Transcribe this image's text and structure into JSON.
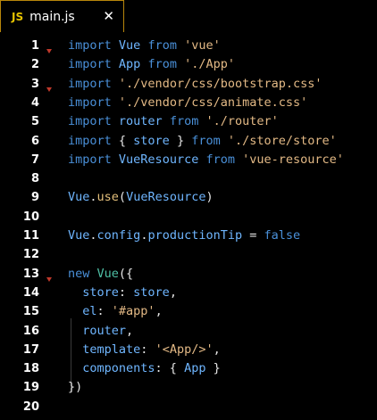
{
  "tab": {
    "icon": "JS",
    "label": "main.js",
    "close_icon": "✕"
  },
  "lines": [
    {
      "n": "1",
      "tokens": [
        [
          "kw",
          "import"
        ],
        [
          "op",
          " "
        ],
        [
          "id",
          "Vue"
        ],
        [
          "op",
          " "
        ],
        [
          "kw",
          "from"
        ],
        [
          "op",
          " "
        ],
        [
          "str",
          "'vue'"
        ]
      ]
    },
    {
      "n": "2",
      "tokens": [
        [
          "kw",
          "import"
        ],
        [
          "op",
          " "
        ],
        [
          "id",
          "App"
        ],
        [
          "op",
          " "
        ],
        [
          "kw",
          "from"
        ],
        [
          "op",
          " "
        ],
        [
          "str",
          "'./App'"
        ]
      ]
    },
    {
      "n": "3",
      "tokens": [
        [
          "kw",
          "import"
        ],
        [
          "op",
          " "
        ],
        [
          "str",
          "'./vendor/css/bootstrap.css'"
        ]
      ]
    },
    {
      "n": "4",
      "tokens": [
        [
          "kw",
          "import"
        ],
        [
          "op",
          " "
        ],
        [
          "str",
          "'./vendor/css/animate.css'"
        ]
      ]
    },
    {
      "n": "5",
      "tokens": [
        [
          "kw",
          "import"
        ],
        [
          "op",
          " "
        ],
        [
          "id",
          "router"
        ],
        [
          "op",
          " "
        ],
        [
          "kw",
          "from"
        ],
        [
          "op",
          " "
        ],
        [
          "str",
          "'./router'"
        ]
      ]
    },
    {
      "n": "6",
      "tokens": [
        [
          "kw",
          "import"
        ],
        [
          "op",
          " { "
        ],
        [
          "id",
          "store"
        ],
        [
          "op",
          " } "
        ],
        [
          "kw",
          "from"
        ],
        [
          "op",
          " "
        ],
        [
          "str",
          "'./store/store'"
        ]
      ]
    },
    {
      "n": "7",
      "tokens": [
        [
          "kw",
          "import"
        ],
        [
          "op",
          " "
        ],
        [
          "id",
          "VueResource"
        ],
        [
          "op",
          " "
        ],
        [
          "kw",
          "from"
        ],
        [
          "op",
          " "
        ],
        [
          "str",
          "'vue-resource'"
        ]
      ]
    },
    {
      "n": "8",
      "tokens": []
    },
    {
      "n": "9",
      "tokens": [
        [
          "id",
          "Vue"
        ],
        [
          "op",
          "."
        ],
        [
          "fn",
          "use"
        ],
        [
          "op",
          "("
        ],
        [
          "id",
          "VueResource"
        ],
        [
          "op",
          ")"
        ]
      ]
    },
    {
      "n": "10",
      "tokens": []
    },
    {
      "n": "11",
      "tokens": [
        [
          "id",
          "Vue"
        ],
        [
          "op",
          "."
        ],
        [
          "id",
          "config"
        ],
        [
          "op",
          "."
        ],
        [
          "id",
          "productionTip"
        ],
        [
          "op",
          " = "
        ],
        [
          "bool",
          "false"
        ]
      ]
    },
    {
      "n": "12",
      "tokens": []
    },
    {
      "n": "13",
      "tokens": [
        [
          "kw",
          "new"
        ],
        [
          "op",
          " "
        ],
        [
          "cls",
          "Vue"
        ],
        [
          "op",
          "({"
        ]
      ]
    },
    {
      "n": "14",
      "tokens": [
        [
          "op",
          "  "
        ],
        [
          "id",
          "store"
        ],
        [
          "op",
          ": "
        ],
        [
          "id",
          "store"
        ],
        [
          "op",
          ","
        ]
      ]
    },
    {
      "n": "15",
      "tokens": [
        [
          "op",
          "  "
        ],
        [
          "id",
          "el"
        ],
        [
          "op",
          ": "
        ],
        [
          "str",
          "'#app'"
        ],
        [
          "op",
          ","
        ]
      ]
    },
    {
      "n": "16",
      "tokens": [
        [
          "op",
          "  "
        ],
        [
          "id",
          "router"
        ],
        [
          "op",
          ","
        ]
      ]
    },
    {
      "n": "17",
      "tokens": [
        [
          "op",
          "  "
        ],
        [
          "id",
          "template"
        ],
        [
          "op",
          ": "
        ],
        [
          "str",
          "'<App/>'"
        ],
        [
          "op",
          ","
        ]
      ]
    },
    {
      "n": "18",
      "tokens": [
        [
          "op",
          "  "
        ],
        [
          "id",
          "components"
        ],
        [
          "op",
          ": { "
        ],
        [
          "id",
          "App"
        ],
        [
          "op",
          " }"
        ]
      ]
    },
    {
      "n": "19",
      "tokens": [
        [
          "op",
          "})"
        ]
      ]
    },
    {
      "n": "20",
      "tokens": []
    }
  ],
  "fold_markers": [
    "1",
    "3",
    "13"
  ],
  "colors": {
    "keyword": "#4a90d9",
    "identifier": "#6fb6ff",
    "string": "#e3b985",
    "function": "#e5c07b",
    "class": "#4fc1a6",
    "background": "#000000",
    "tab_border": "#b8860b"
  }
}
